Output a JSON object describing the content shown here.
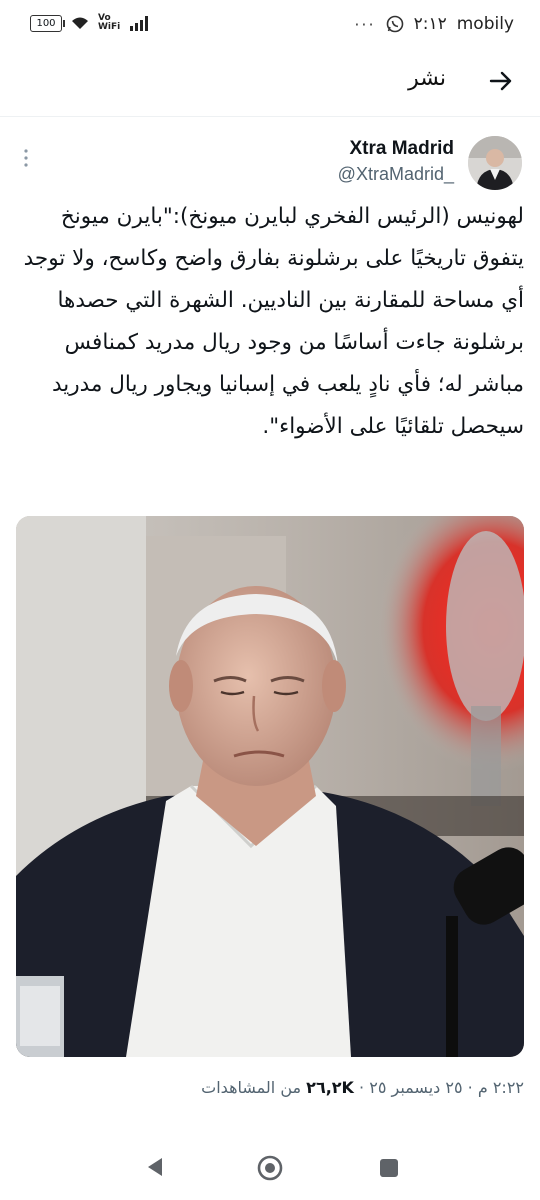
{
  "status_bar": {
    "battery": "100",
    "wifi_label": "Vo WiFi",
    "time": "٢:١٢",
    "carrier": "mobily",
    "icons": [
      "signal-icon",
      "wifi-icon",
      "whatsapp-icon",
      "more-dots-icon"
    ]
  },
  "header": {
    "title": "نشر",
    "back_icon": "arrow-right-icon"
  },
  "tweet": {
    "author_name": "Xtra Madrid",
    "author_handle": "@XtraMadrid_",
    "text": "لهونيس (الرئيس الفخري لبايرن ميونخ):\"بايرن ميونخ يتفوق تاريخيًا على برشلونة بفارق واضح وكاسح، ولا توجد أي مساحة للمقارنة بين الناديين. الشهرة التي حصدها برشلونة جاءت أساسًا من وجود ريال مدريد كمنافس مباشر له؛ فأي نادٍ يلعب في إسبانيا ويجاور ريال مدريد سيحصل تلقائيًا على الأضواء\".",
    "time": "٢:٢٢ م",
    "date": "٢٥ ديسمبر ٢٥",
    "views_count": "٢٦,٢K",
    "views_label": "من المشاهدات",
    "separator": "·"
  },
  "nav": {
    "icons": [
      "nav-back-icon",
      "nav-home-icon",
      "nav-recents-icon"
    ]
  },
  "colors": {
    "text": "#0f1419",
    "secondary": "#536471",
    "background": "#ffffff"
  }
}
